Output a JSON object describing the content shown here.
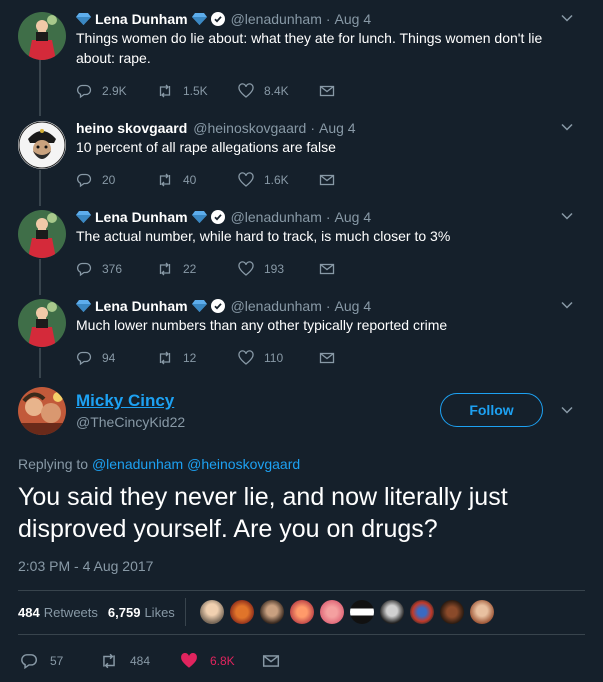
{
  "thread": [
    {
      "name": "Lena Dunham",
      "handle": "@lenadunham",
      "date": "Aug 4",
      "text": "Things women do lie about: what they ate for lunch. Things women don't lie about: rape.",
      "replies": "2.9K",
      "retweets": "1.5K",
      "likes": "8.4K"
    },
    {
      "name": "heino skovgaard",
      "handle": "@heinoskovgaard",
      "date": "Aug 4",
      "text": "10 percent of all rape allegations are false",
      "replies": "20",
      "retweets": "40",
      "likes": "1.6K"
    },
    {
      "name": "Lena Dunham",
      "handle": "@lenadunham",
      "date": "Aug 4",
      "text": "The actual number, while hard to track, is much closer to 3%",
      "replies": "376",
      "retweets": "22",
      "likes": "193"
    },
    {
      "name": "Lena Dunham",
      "handle": "@lenadunham",
      "date": "Aug 4",
      "text": "Much lower numbers than any other typically reported crime",
      "replies": "94",
      "retweets": "12",
      "likes": "110"
    }
  ],
  "separator": "·",
  "focus": {
    "name": "Micky Cincy",
    "handle": "@TheCincyKid22",
    "follow_label": "Follow",
    "replying_prefix": "Replying to",
    "replying_to_1": "@lenadunham",
    "replying_to_2": "@heinoskovgaard",
    "text": "You said they never lie, and now literally just disproved yourself. Are you on drugs?",
    "timestamp": "2:03 PM - 4 Aug 2017",
    "retweets_count": "484",
    "retweets_label": "Retweets",
    "likes_count": "6,759",
    "likes_label": "Likes",
    "replies": "57",
    "retweets": "484",
    "likes": "6.8K"
  },
  "colors": {
    "background": "#15202b",
    "accent": "#1da1f2",
    "muted": "#8899a6",
    "like": "#e0245e",
    "divider": "#38444d"
  },
  "icons": [
    "diamond-emoji-icon",
    "verified-badge-icon",
    "chevron-down-icon",
    "reply-icon",
    "retweet-icon",
    "heart-icon",
    "direct-message-icon"
  ]
}
